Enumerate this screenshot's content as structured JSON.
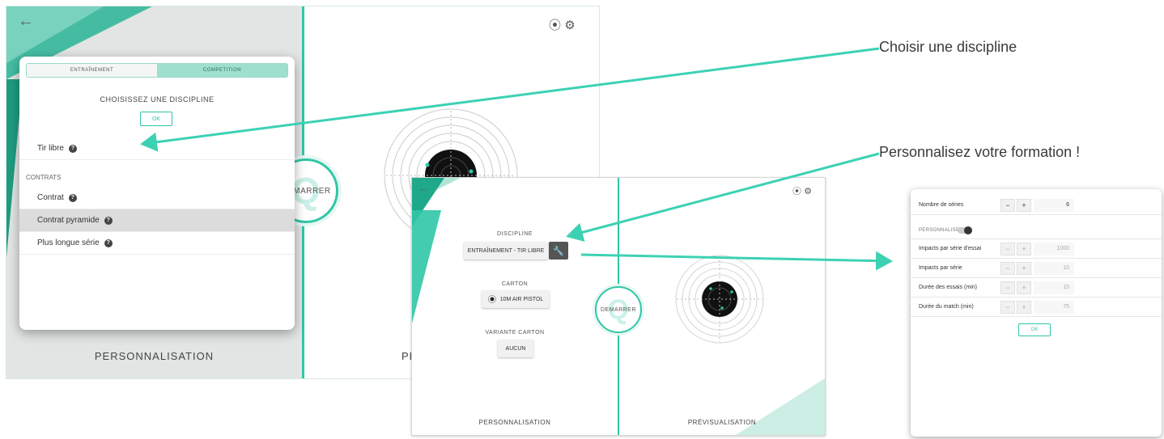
{
  "screen1": {
    "bottom_label": "PERSONNALISATION",
    "preview_label_partial": "PRE",
    "start_label": "DEMARRER",
    "modal": {
      "tabs": [
        "ENTRAÎNEMENT",
        "COMPETITION"
      ],
      "title": "CHOISISSEZ UNE DISCIPLINE",
      "ok": "OK",
      "item_tir_libre": "Tir libre",
      "section_contrats": "CONTRATS",
      "item_contrat": "Contrat",
      "item_contrat_pyramide": "Contrat pyramide",
      "item_plus_longue_serie": "Plus longue série"
    }
  },
  "screen2": {
    "discipline_label": "DISCIPLINE",
    "discipline_value": "ENTRAÎNEMENT - TIR LIBRE",
    "carton_label": "CARTON",
    "carton_value": "10M AIR PISTOL",
    "variante_label": "VARIANTE CARTON",
    "variante_value": "AUCUN",
    "start_label": "DEMARRER",
    "left_label": "PERSONNALISATION",
    "right_label": "PRÉVISUALISATION"
  },
  "screen3": {
    "rows": [
      {
        "label": "Nombre de séries",
        "value": "6",
        "minus": "−",
        "plus": "+"
      },
      {
        "label": "Impacts par série d'essai",
        "value": "1000",
        "minus": "−",
        "plus": "+"
      },
      {
        "label": "Impacts par série",
        "value": "10",
        "minus": "−",
        "plus": "+"
      },
      {
        "label": "Durée des essais (min)",
        "value": "15",
        "minus": "−",
        "plus": "+"
      },
      {
        "label": "Durée du match (min)",
        "value": "75",
        "minus": "−",
        "plus": "+"
      }
    ],
    "personnaliser_label": "PERSONNALISER",
    "ok": "OK"
  },
  "annotations": {
    "choose": "Choisir une discipline",
    "customize": "Personnalisez votre formation !"
  },
  "colors": {
    "accent": "#2fc7a6",
    "accent_dark": "#1fa88a",
    "arrow": "#3dd1b4"
  },
  "icons": {
    "back": "back-arrow-icon",
    "wifi": "wireless-icon",
    "settings": "gear-icon",
    "help": "help-icon",
    "wrench": "wrench-icon",
    "target": "target-icon"
  }
}
